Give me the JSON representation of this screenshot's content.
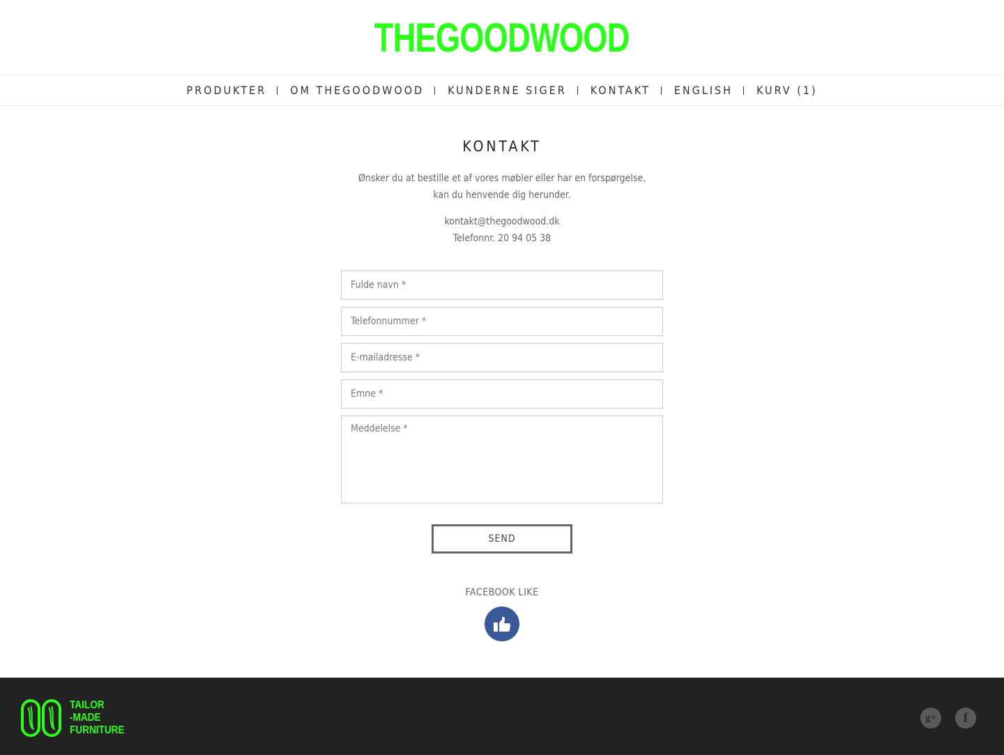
{
  "header": {
    "logo_text": "THEGOODWOOD"
  },
  "nav": {
    "items": [
      {
        "label": "PRODUKTER"
      },
      {
        "label": "OM THEGOODWOOD"
      },
      {
        "label": "KUNDERNE SIGER"
      },
      {
        "label": "KONTAKT"
      },
      {
        "label": "ENGLISH"
      },
      {
        "label": "KURV (1)"
      }
    ]
  },
  "main": {
    "title": "KONTAKT",
    "intro": "Ønsker du at bestille et af vores møbler eller har en forspørgelse, kan du henvende dig herunder.",
    "email": "kontakt@thegoodwood.dk",
    "phone": "Telefonnr. 20 94 05 38"
  },
  "form": {
    "name_placeholder": "Fulde navn *",
    "phone_placeholder": "Telefonnummer *",
    "email_placeholder": "E-mailadresse *",
    "subject_placeholder": "Emne *",
    "message_placeholder": "Meddelelse *",
    "send_label": "SEND"
  },
  "facebook": {
    "like_label": "FACEBOOK LIKE",
    "icon": "thumbs-up-icon"
  },
  "footer": {
    "tagline": [
      "TAILOR",
      "-MADE",
      "FURNITURE"
    ],
    "social": [
      {
        "icon": "google-plus-icon"
      },
      {
        "icon": "facebook-icon"
      }
    ]
  },
  "colors": {
    "brand_green": "#2bff1a",
    "footer_bg": "#222222",
    "facebook_blue": "#3b5998"
  }
}
